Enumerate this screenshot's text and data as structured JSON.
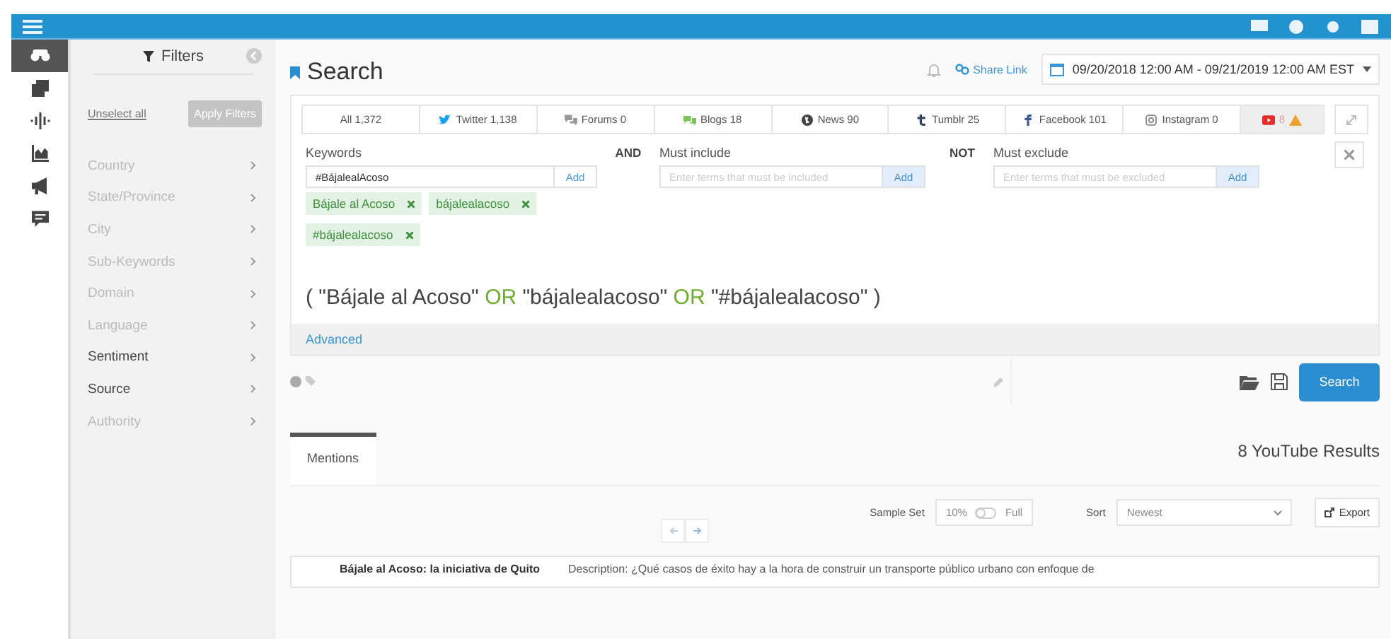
{
  "rail": [
    {
      "kind": "binoculars",
      "selected": true
    },
    {
      "kind": "copy",
      "selected": false
    },
    {
      "kind": "wave",
      "selected": false
    },
    {
      "kind": "chart",
      "selected": false
    },
    {
      "kind": "megaphone",
      "selected": false
    },
    {
      "kind": "comment",
      "selected": false
    }
  ],
  "filters": {
    "title": "Filters",
    "unselect": "Unselect all",
    "apply": "Apply Filters",
    "items": [
      {
        "label": "Country",
        "disabled": true
      },
      {
        "label": "State/Province",
        "disabled": true
      },
      {
        "label": "City",
        "disabled": true
      },
      {
        "label": "Sub-Keywords",
        "disabled": true
      },
      {
        "label": "Domain",
        "disabled": true
      },
      {
        "label": "Language",
        "disabled": true
      },
      {
        "label": "Sentiment",
        "disabled": false
      },
      {
        "label": "Source",
        "disabled": false
      },
      {
        "label": "Authority",
        "disabled": true
      }
    ]
  },
  "search": {
    "title": "Search",
    "share_link": "Share Link",
    "date_range": "09/20/2018 12:00 AM - 09/21/2019 12:00 AM EST",
    "source_tabs": [
      {
        "kind": "all",
        "label": "All 1,372",
        "selected": false
      },
      {
        "kind": "twitter",
        "label": "Twitter 1,138",
        "selected": false
      },
      {
        "kind": "forums",
        "label": "Forums 0",
        "selected": false
      },
      {
        "kind": "blogs",
        "label": "Blogs 18",
        "selected": false
      },
      {
        "kind": "news",
        "label": "News 90",
        "selected": false
      },
      {
        "kind": "tumblr",
        "label": "Tumblr 25",
        "selected": false
      },
      {
        "kind": "facebook",
        "label": "Facebook 101",
        "selected": false
      },
      {
        "kind": "instagram",
        "label": "Instagram 0",
        "selected": false
      },
      {
        "kind": "youtube",
        "label": "8",
        "selected": true
      }
    ],
    "keywords": {
      "label": "Keywords",
      "value": "#BájalealAcoso",
      "add": "Add",
      "tags": [
        "Bájale al Acoso",
        "bájalealacoso",
        "#bájalealacoso"
      ]
    },
    "and": "AND",
    "must_include": {
      "label": "Must include",
      "placeholder": "Enter terms that must be included",
      "add": "Add"
    },
    "not": "NOT",
    "must_exclude": {
      "label": "Must exclude",
      "placeholder": "Enter terms that must be excluded",
      "add": "Add"
    },
    "query": [
      {
        "kind": "term",
        "text": "( \"Bájale al Acoso\""
      },
      {
        "kind": "operator",
        "text": "OR"
      },
      {
        "kind": "term",
        "text": "\"bájalealacoso\""
      },
      {
        "kind": "operator",
        "text": "OR"
      },
      {
        "kind": "term",
        "text": "\"#bájalealacoso\" )"
      }
    ],
    "advanced": "Advanced",
    "search_button": "Search"
  },
  "results": {
    "tab": "Mentions",
    "count": "8 YouTube Results",
    "sample_label": "Sample Set",
    "sample_low": "10%",
    "sample_high": "Full",
    "sort_label": "Sort",
    "sort_value": "Newest",
    "export": "Export",
    "rows": [
      {
        "title": "Bájale al Acoso: la iniciativa de Quito",
        "description": "Description: ¿Qué casos de éxito hay a la hora de construir un transporte público urbano con enfoque de"
      }
    ]
  }
}
